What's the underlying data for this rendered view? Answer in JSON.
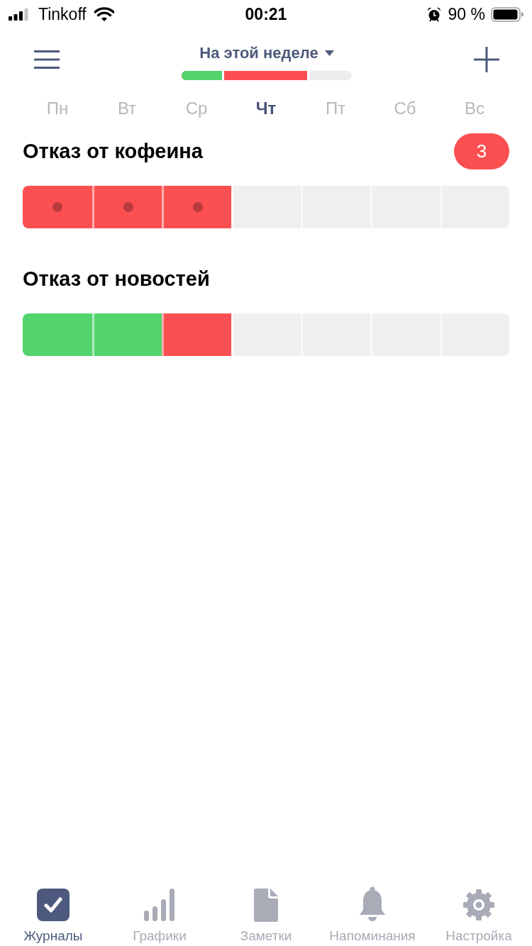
{
  "status_bar": {
    "carrier": "Tinkoff",
    "time": "00:21",
    "battery": "90 %"
  },
  "header": {
    "title": "На этой неделе",
    "progress": [
      {
        "color": "#52d36c",
        "level": 0.25
      },
      {
        "color": "#fc4f51",
        "level": 0.75
      }
    ]
  },
  "weekdays": [
    {
      "label": "Пн",
      "selected": false
    },
    {
      "label": "Вт",
      "selected": false
    },
    {
      "label": "Ср",
      "selected": false
    },
    {
      "label": "Чт",
      "selected": true
    },
    {
      "label": "Пт",
      "selected": false
    },
    {
      "label": "Сб",
      "selected": false
    },
    {
      "label": "Вс",
      "selected": false
    }
  ],
  "habits": [
    {
      "title": "Отказ от кофеина",
      "badge": "3",
      "days": [
        {
          "color": "#fc4f51",
          "dot": true
        },
        {
          "color": "#fc4f51",
          "dot": true
        },
        {
          "color": "#fc4f51",
          "dot": true
        },
        {
          "color": "#efeff1",
          "dot": false
        },
        {
          "color": "#efeff1",
          "dot": false
        },
        {
          "color": "#efeff1",
          "dot": false
        },
        {
          "color": "#efeff1",
          "dot": false
        }
      ]
    },
    {
      "title": "Отказ от новостей",
      "days": [
        {
          "color": "#52d36c",
          "dot": false
        },
        {
          "color": "#52d36c",
          "dot": false
        },
        {
          "color": "#fc4f51",
          "dot": false
        },
        {
          "color": "#efeff1",
          "dot": false
        },
        {
          "color": "#efeff1",
          "dot": false
        },
        {
          "color": "#efeff1",
          "dot": false
        },
        {
          "color": "#efeff1",
          "dot": false
        }
      ]
    }
  ],
  "tab_bar": [
    {
      "label": "Журналы",
      "selected": true
    },
    {
      "label": "Графики",
      "selected": false
    },
    {
      "label": "Заметки",
      "selected": false
    },
    {
      "label": "Напоминания",
      "selected": false
    },
    {
      "label": "Настройка",
      "selected": false
    }
  ]
}
